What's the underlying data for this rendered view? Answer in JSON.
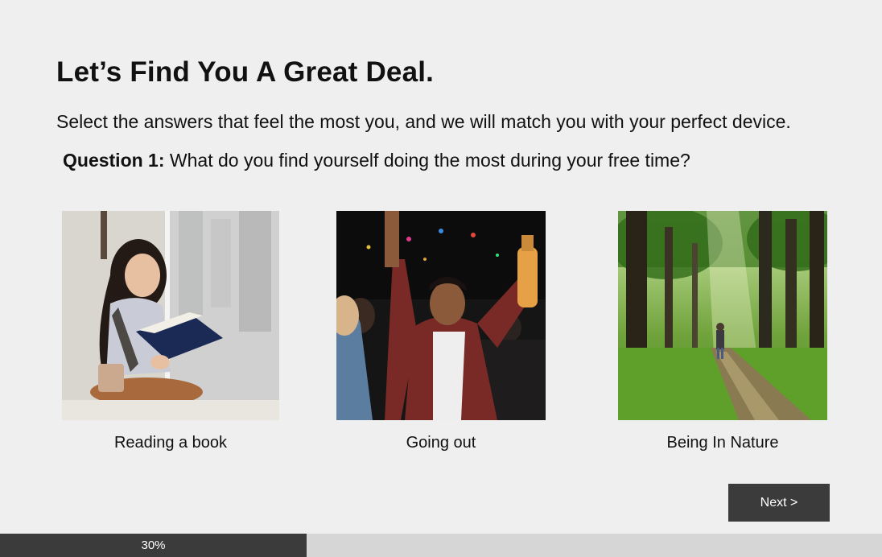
{
  "header": {
    "title": "Let’s Find You A Great Deal.",
    "subtitle": "Select the answers that feel the most you, and we will match you with your perfect device."
  },
  "question": {
    "number_label": "Question 1:",
    "text": " What do you find yourself doing the most during your free time?"
  },
  "options": [
    {
      "label": "Reading a book",
      "image": "woman-reading-book-by-window"
    },
    {
      "label": "Going out",
      "image": "woman-dancing-at-party"
    },
    {
      "label": "Being In Nature",
      "image": "person-walking-forest-path"
    }
  ],
  "actions": {
    "next_label": "Next >"
  },
  "progress": {
    "value": 0.3,
    "label": "30%"
  },
  "colors": {
    "background": "#efefef",
    "button": "#3b3b3b",
    "progress_fill": "#3b3b3b",
    "progress_track": "#d6d6d6"
  }
}
